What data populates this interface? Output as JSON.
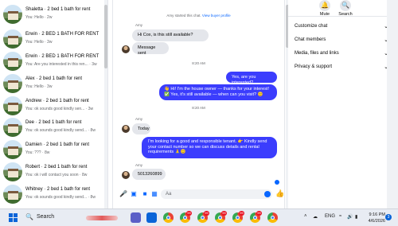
{
  "chat_list": [
    {
      "title": "Shaletta · 2 bed 1 bath for rent",
      "sub": "You: Hello · 2w"
    },
    {
      "title": "Erwin · 2 BED 1 BATH FOR RENT",
      "sub": "You: Hello · 3w"
    },
    {
      "title": "Erwin · 2 BED 1 BATH FOR RENT",
      "sub": "You: Are you interested in this ren... · 3w"
    },
    {
      "title": "Alex · 2 bed 1 bath for rent",
      "sub": "You: Hello · 3w"
    },
    {
      "title": "Andrew · 2 bed 1 bath for rent",
      "sub": "You: ok sounds good kindly sen... · 3w"
    },
    {
      "title": "Dee · 2 bed 1 bath for rent",
      "sub": "You: ok sounds good kindly send... · 8w"
    },
    {
      "title": "Damien · 2 bed 1 bath for rent",
      "sub": "You: ??? · 8w"
    },
    {
      "title": "Robert · 2 bed 1 bath for rent",
      "sub": "You: ok i will contact you soon · 8w"
    },
    {
      "title": "Whitney · 2 bed 1 bath for rent",
      "sub": "You: ok sounds good kindly send... · 8w"
    }
  ],
  "conversation": {
    "system_text": "Amy started this chat.",
    "system_link": "View buyer profile",
    "sender_name": "Amy",
    "messages": [
      {
        "dir": "in",
        "text": "Hi Cox, is this still available?"
      },
      {
        "dir": "in",
        "text": "Message sent"
      },
      {
        "dir": "time",
        "text": "8:20 AM"
      },
      {
        "dir": "out",
        "text": "Yes, are you interested?"
      },
      {
        "dir": "out",
        "text": "👋 Hi! I'm the house owner — thanks for your interest! ✅ Yes, it's still available — when can you visit? 😊"
      },
      {
        "dir": "time",
        "text": "8:20 AM"
      },
      {
        "dir": "name",
        "text": "Amy"
      },
      {
        "dir": "in",
        "text": "Today"
      },
      {
        "dir": "out",
        "text": "I'm looking for a good and responsible tenant. 👉 Kindly send your contact number so we can discuss details and rental requirements 🙏😊"
      },
      {
        "dir": "name",
        "text": "Amy"
      },
      {
        "dir": "in",
        "text": "5013260899"
      }
    ],
    "composer_placeholder": "Aa"
  },
  "info_panel": {
    "mute_label": "Mute",
    "search_label": "Search",
    "sections": [
      "Customize chat",
      "Chat members",
      "Media, files and links",
      "Privacy & support"
    ]
  },
  "taskbar": {
    "search_placeholder": "Search",
    "badges": [
      "99",
      "99",
      "99",
      "99",
      "99"
    ],
    "language": "ENG",
    "time": "9:16 PM",
    "date": "4/6/2026",
    "notification_count": "3"
  },
  "colors": {
    "accent": "#0866ff",
    "outgoing_bubble": "#3b3dfd",
    "incoming_bubble": "#e4e6eb"
  }
}
